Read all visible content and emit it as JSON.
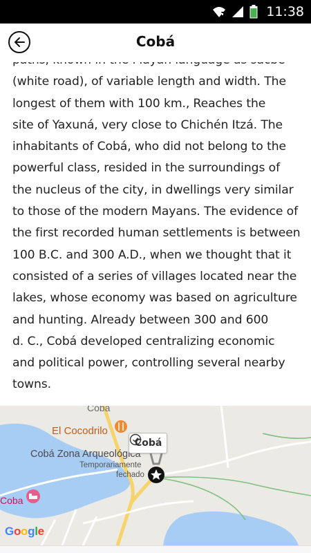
{
  "status_bar": {
    "time": "11:38",
    "icons": [
      "wifi-icon",
      "signal-icon",
      "battery-icon"
    ],
    "battery_color": "#4caf50"
  },
  "app_bar": {
    "title": "Cobá",
    "back_icon": "arrow-left-icon"
  },
  "article": {
    "lines": [
      "paths, known in the Mayan language as sacbe",
      "(white road), of variable length and width. The",
      "longest of them with 100 km., Reaches the",
      "site of Yaxuná, very close to Chichén Itzá. The",
      "inhabitants of Cobá, who did not belong to the",
      "powerful class, resided in the surroundings of",
      "the nucleus of the city, in dwellings very similar",
      "to those of the modern Mayans. The evidence of",
      "the first recorded human settlements is between",
      "100 B.C. and 300 A.D., when we thought that it",
      "consisted of a series of villages located near the",
      "lakes, whose economy was based on agriculture",
      "and hunting. Already between 300 and 600",
      "d. C., Cobá developed centralizing economic",
      "and political power, controlling several nearby",
      "towns."
    ]
  },
  "map": {
    "labels": {
      "town_top": "Coba",
      "restaurant": "El Cocodrilo",
      "archaeological_zone": "Cobá Zona Arqueológica",
      "status_line1": "Temporariamente",
      "status_line2": "fechado",
      "town_left": "Coba"
    },
    "callout": "Cobá",
    "google_logo": [
      "G",
      "o",
      "o",
      "g",
      "l",
      "e"
    ],
    "colors": {
      "water": "#a8cdf5",
      "land": "#eceae5",
      "road_yellow": "#f6d36b",
      "park_green": "#7fbf7f",
      "restaurant_orange": "#f28b30",
      "hotel_pink": "#e45f8e",
      "pin_dark": "#111111"
    }
  }
}
